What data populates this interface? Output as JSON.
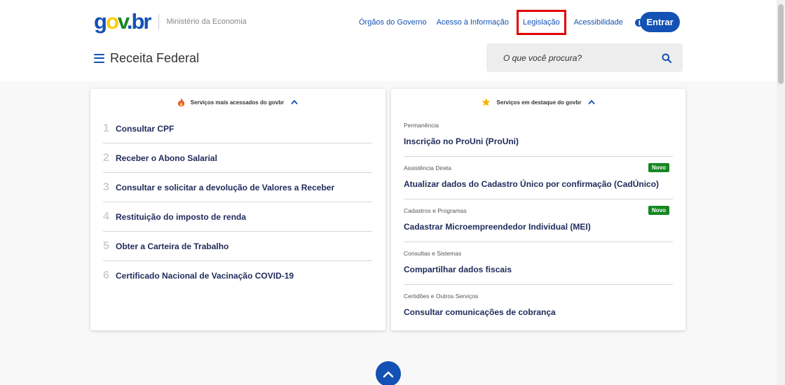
{
  "header": {
    "logo_text": "gov.br",
    "ministry": "Ministério da Economia",
    "nav": [
      {
        "label": "Órgãos do Governo"
      },
      {
        "label": "Acesso à Informação"
      },
      {
        "label": "Legislação"
      },
      {
        "label": "Acessibilidade"
      }
    ],
    "login_label": "Entrar",
    "site_title": "Receita Federal",
    "search_placeholder": "O que você procura?"
  },
  "most_accessed": {
    "title": "Serviços mais acessados do govbr",
    "items": [
      {
        "num": "1",
        "label": "Consultar CPF"
      },
      {
        "num": "2",
        "label": "Receber o Abono Salarial"
      },
      {
        "num": "3",
        "label": "Consultar e solicitar a devolução de Valores a Receber"
      },
      {
        "num": "4",
        "label": "Restituição do imposto de renda"
      },
      {
        "num": "5",
        "label": "Obter a Carteira de Trabalho"
      },
      {
        "num": "6",
        "label": "Certificado Nacional de Vacinação COVID-19"
      }
    ]
  },
  "featured": {
    "title": "Serviços em destaque do govbr",
    "items": [
      {
        "category": "Permanência",
        "label": "Inscrição no ProUni (ProUni)",
        "badge": ""
      },
      {
        "category": "Assistência Direta",
        "label": "Atualizar dados do Cadastro Único por confirmação (CadÚnico)",
        "badge": "Novo"
      },
      {
        "category": "Cadastros e Programas",
        "label": "Cadastrar Microempreendedor Individual (MEI)",
        "badge": "Novo"
      },
      {
        "category": "Consultas e Sistemas",
        "label": "Compartilhar dados fiscais",
        "badge": ""
      },
      {
        "category": "Certidões e Outros Serviços",
        "label": "Consultar comunicações de cobrança",
        "badge": ""
      }
    ]
  },
  "colors": {
    "brand_blue": "#1351b4",
    "brand_yellow": "#ffcd07",
    "brand_green": "#168821",
    "highlight_red": "#e00000"
  }
}
